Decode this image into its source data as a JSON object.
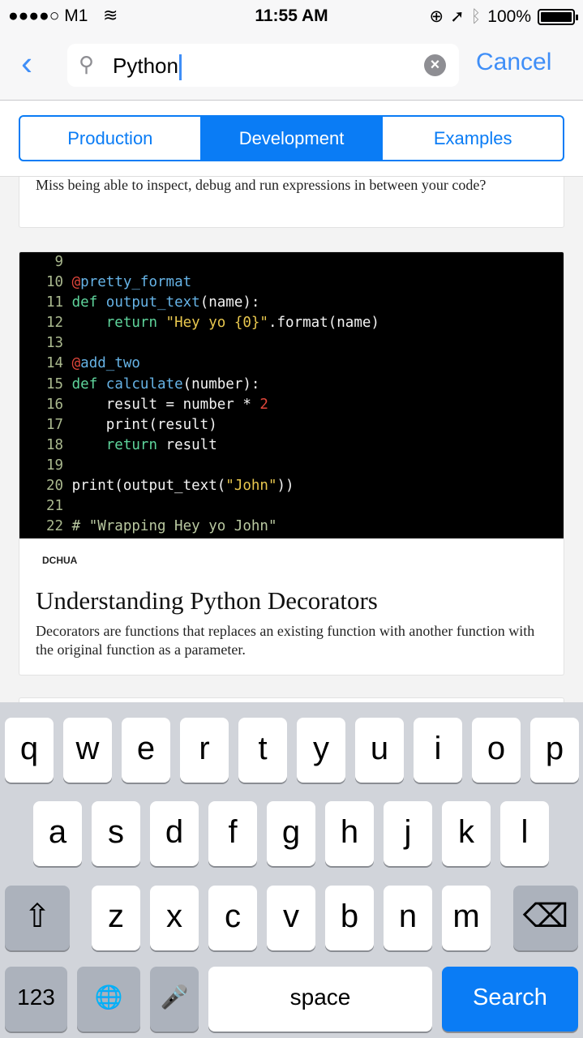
{
  "status": {
    "carrier": "●●●●○ M1",
    "wifi_icon": "wifi-icon",
    "time": "11:55 AM",
    "battery": "100%",
    "battery_level": 1.0
  },
  "nav": {
    "search_value": "Python",
    "cancel": "Cancel"
  },
  "segments": [
    {
      "label": "Production",
      "active": false
    },
    {
      "label": "Development",
      "active": true
    },
    {
      "label": "Examples",
      "active": false
    }
  ],
  "card_prev": {
    "desc": "Miss being able to inspect, debug and run expressions in between your code?"
  },
  "code_colors": {
    "ln": "#aab98e",
    "at": "#e2463b",
    "dec": "#66b3e6",
    "kw": "#5fd59c",
    "fn": "#66b3e6",
    "str": "#e8c74e",
    "num": "#e2463b",
    "cm": "#b9c8a0",
    "tx": "#f3f3f3"
  },
  "code_lines": [
    {
      "n": " 9",
      "t": []
    },
    {
      "n": "10",
      "t": [
        [
          "@",
          "at"
        ],
        [
          "pretty_format",
          "dec"
        ]
      ]
    },
    {
      "n": "11",
      "t": [
        [
          "def ",
          "kw"
        ],
        [
          "output_text",
          "fn"
        ],
        [
          "(name):",
          "tx"
        ]
      ]
    },
    {
      "n": "12",
      "t": [
        [
          "    return ",
          "kw"
        ],
        [
          "\"Hey yo {0}\"",
          "str"
        ],
        [
          ".format(name)",
          "tx"
        ]
      ]
    },
    {
      "n": "13",
      "t": []
    },
    {
      "n": "14",
      "t": [
        [
          "@",
          "at"
        ],
        [
          "add_two",
          "dec"
        ]
      ]
    },
    {
      "n": "15",
      "t": [
        [
          "def ",
          "kw"
        ],
        [
          "calculate",
          "fn"
        ],
        [
          "(number):",
          "tx"
        ]
      ]
    },
    {
      "n": "16",
      "t": [
        [
          "    result = number * ",
          "tx"
        ],
        [
          "2",
          "num"
        ]
      ]
    },
    {
      "n": "17",
      "t": [
        [
          "    print(result)",
          "tx"
        ]
      ]
    },
    {
      "n": "18",
      "t": [
        [
          "    return ",
          "kw"
        ],
        [
          "result",
          "tx"
        ]
      ]
    },
    {
      "n": "19",
      "t": []
    },
    {
      "n": "20",
      "t": [
        [
          "print(output_text(",
          "tx"
        ],
        [
          "\"John\"",
          "str"
        ],
        [
          "))",
          "tx"
        ]
      ]
    },
    {
      "n": "21",
      "t": []
    },
    {
      "n": "22",
      "t": [
        [
          "# \"Wrapping Hey yo John\"",
          "cm"
        ]
      ]
    }
  ],
  "article": {
    "author": "DCHUA",
    "title": "Understanding Python Decorators",
    "desc": "Decorators are functions that replaces an existing function with another function with the original function as a parameter."
  },
  "keyboard": {
    "row1": [
      "q",
      "w",
      "e",
      "r",
      "t",
      "y",
      "u",
      "i",
      "o",
      "p"
    ],
    "row2": [
      "a",
      "s",
      "d",
      "f",
      "g",
      "h",
      "j",
      "k",
      "l"
    ],
    "row3": [
      "z",
      "x",
      "c",
      "v",
      "b",
      "n",
      "m"
    ],
    "shift": "⇧",
    "delete": "⌫",
    "numbers": "123",
    "globe": "🌐",
    "mic": "🎤",
    "space": "space",
    "search": "Search"
  }
}
